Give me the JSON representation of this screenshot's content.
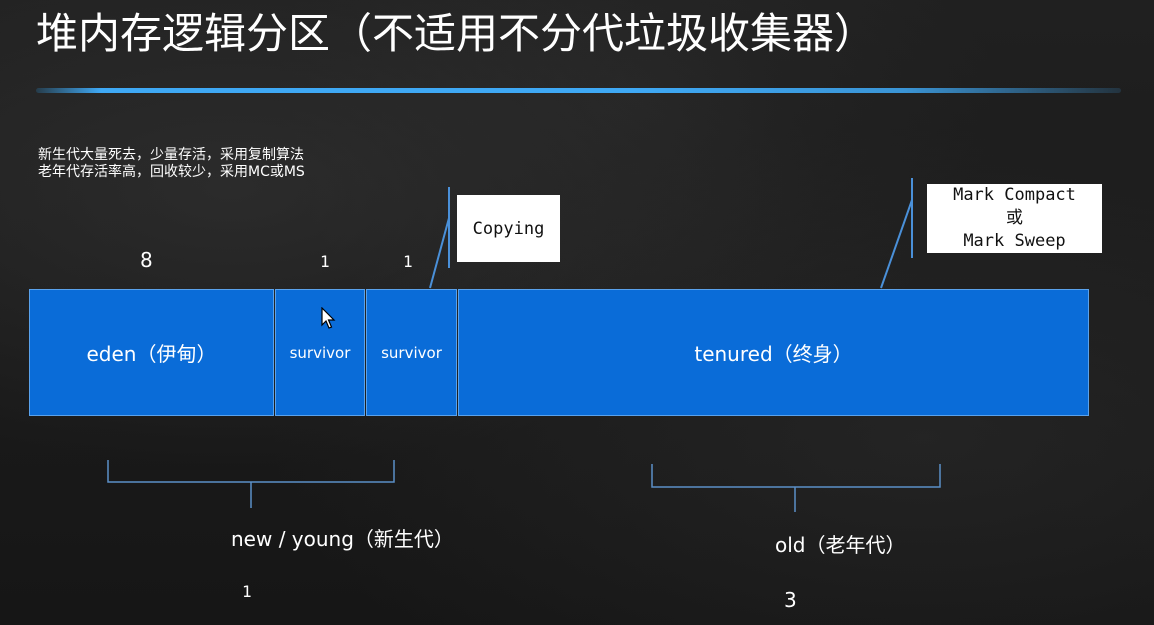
{
  "title": "堆内存逻辑分区（不适用不分代垃圾收集器）",
  "notes": [
    "新生代大量死去，少量存活，采用复制算法",
    "老年代存活率高，回收较少，采用MC或MS"
  ],
  "regions": {
    "eden": {
      "label": "eden（伊甸）",
      "ratio": "8"
    },
    "survivor_1": {
      "label": "survivor",
      "ratio": "1"
    },
    "survivor_2": {
      "label": "survivor",
      "ratio": "1"
    },
    "tenured": {
      "label": "tenured（终身）"
    }
  },
  "callouts": {
    "copying": "Copying",
    "mark_compact": "Mark Compact",
    "or": "或",
    "mark_sweep": "Mark Sweep"
  },
  "groups": {
    "young": {
      "label": "new / young（新生代）",
      "ratio": "1"
    },
    "old": {
      "label": "old（老年代）",
      "ratio": "3"
    }
  },
  "colors": {
    "region_fill": "#0a6cd8",
    "title_rule": "#3fa9f5",
    "bracket": "#5b8fc7",
    "callout_line": "#4a90d9"
  },
  "icons": {
    "cursor": "mouse-pointer-icon"
  }
}
